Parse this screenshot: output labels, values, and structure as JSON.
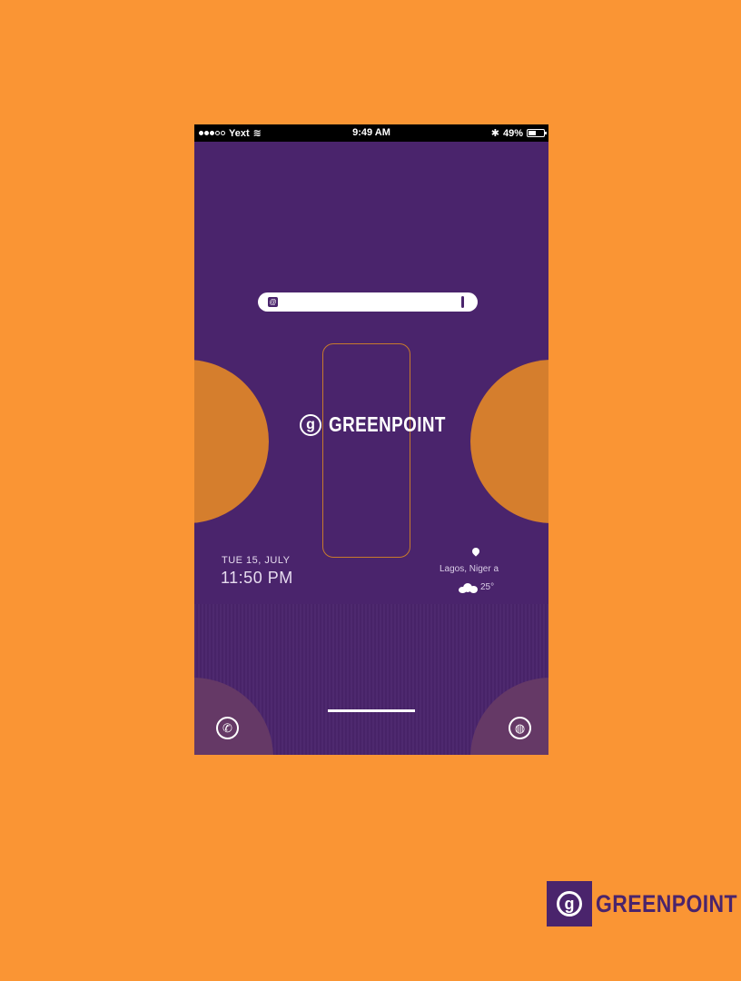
{
  "status_bar": {
    "carrier": "Yext",
    "time": "9:49 AM",
    "battery": "49%",
    "battery_level": 0.49,
    "signal_bars_filled": 3,
    "signal_bars_total": 5
  },
  "search": {
    "logo_glyph": "@",
    "mic_icon": "microphone-icon"
  },
  "brand": {
    "icon_glyph": "g",
    "name": "GREENPOINT"
  },
  "clock": {
    "date": "TUE 15, JULY",
    "time": "11:50 PM"
  },
  "weather": {
    "location": "Lagos, Niger a",
    "temperature": "25°",
    "icon": "cloud-icon"
  },
  "dock": {
    "left_icon": "phone-icon",
    "right_icon": "dribbble-icon",
    "phone_glyph": "✆",
    "dribbble_glyph": "◍"
  },
  "footer_logo": {
    "icon_glyph": "g",
    "name": "GREENPOINT"
  },
  "colors": {
    "background": "#fa9534",
    "phone": "#4a246c",
    "accent": "#d57e2d",
    "dock_circles": "#653966"
  }
}
